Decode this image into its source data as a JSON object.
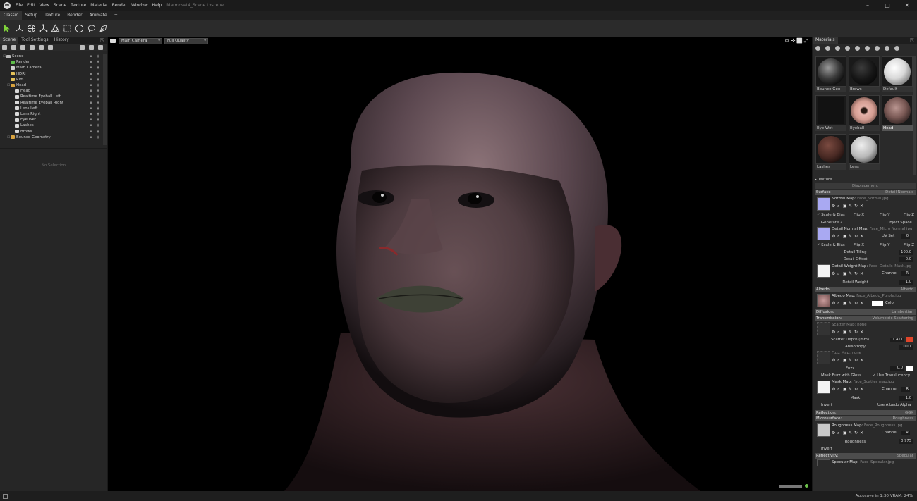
{
  "title_bar": {
    "logo_glyph": "m",
    "menu": [
      "File",
      "Edit",
      "View",
      "Scene",
      "Texture",
      "Material",
      "Render",
      "Window",
      "Help"
    ],
    "window_title": "Marmoset4_Scene.tbscene",
    "controls": [
      "–",
      "□",
      "✕"
    ]
  },
  "mode_tabs": [
    "Classic",
    "Setup",
    "Texture",
    "Render",
    "Animate",
    "+"
  ],
  "toolbar_icons": [
    "select-arrow-icon",
    "move-gizmo-icon",
    "rotate-gizmo-icon",
    "scale-gizmo-icon",
    "transform-gizmo-icon",
    "box-select-icon",
    "circle-select-icon",
    "lasso-icon",
    "paint-select-icon"
  ],
  "left_panel": {
    "tabs": [
      "Scene",
      "Tool Settings",
      "History"
    ],
    "pop_glyph": "⇱",
    "tree": [
      {
        "label": "Scene",
        "indent": 0,
        "icon": "#bbbbbb"
      },
      {
        "label": "Render",
        "indent": 1,
        "icon": "#5fbf4a"
      },
      {
        "label": "Main Camera",
        "indent": 1,
        "icon": "#cfcfcf"
      },
      {
        "label": "HDRI",
        "indent": 1,
        "icon": "#e6c35a"
      },
      {
        "label": "Rim",
        "indent": 1,
        "icon": "#e6c35a"
      },
      {
        "label": "Head",
        "indent": 1,
        "icon": "#d9a33f"
      },
      {
        "label": "Head",
        "indent": 2,
        "icon": "#d9d9d9"
      },
      {
        "label": "Realtime Eyeball Left",
        "indent": 2,
        "icon": "#d9d9d9"
      },
      {
        "label": "Realtime Eyeball Right",
        "indent": 2,
        "icon": "#d9d9d9"
      },
      {
        "label": "Lens Left",
        "indent": 2,
        "icon": "#d9d9d9"
      },
      {
        "label": "Lens Right",
        "indent": 2,
        "icon": "#d9d9d9"
      },
      {
        "label": "Eye Wet",
        "indent": 2,
        "icon": "#d9d9d9"
      },
      {
        "label": "Lashes",
        "indent": 2,
        "icon": "#d9d9d9"
      },
      {
        "label": "Brows",
        "indent": 2,
        "icon": "#d9d9d9"
      },
      {
        "label": "Bounce Geometry",
        "indent": 1,
        "icon": "#d9a33f"
      }
    ],
    "lock_glyph": "🔒",
    "eye_glyph": "👁",
    "no_selection": "No Selection"
  },
  "viewport": {
    "camera_select": "Main Camera",
    "quality_select": "Full Quality",
    "caret": "▾",
    "right_icons": [
      "⚙",
      "✛",
      "⬜",
      "⤢"
    ]
  },
  "right_panel": {
    "tab": "Materials",
    "materials": [
      {
        "label": "Bounce Geo",
        "swatch": "radial-gradient(circle at 40% 35%, #9a9a9a 0%, #3c3c3c 45%, #101010 75%)",
        "selected": false
      },
      {
        "label": "Brows",
        "swatch": "radial-gradient(circle at 40% 35%, #3c3c3c 0%, #161616 50%, #080808 80%)",
        "selected": false
      },
      {
        "label": "Default",
        "swatch": "radial-gradient(circle at 40% 35%, #ffffff 0%, #d8d8d8 45%, #7a7a7a 80%)",
        "selected": false
      },
      {
        "label": "Eye Wet",
        "swatch": "#121212",
        "selected": false
      },
      {
        "label": "Eyeball",
        "swatch": "radial-gradient(circle at 50% 50%, #2a1a14 0%, #2a1a14 14%, #e6b3aa 22%, #d49d92 50%, #6a4a44 80%)",
        "selected": false
      },
      {
        "label": "Head",
        "swatch": "radial-gradient(circle at 45% 40%, #b99590 0%, #7a5955 45%, #2e2120 80%)",
        "selected": true
      },
      {
        "label": "Lashes",
        "swatch": "radial-gradient(circle at 40% 35%, #7a4a40 0%, #4a2a24 50%, #1c100e 80%)",
        "selected": false
      },
      {
        "label": "Lens",
        "swatch": "radial-gradient(circle at 40% 35%, #eeeeee 0%, #b8b8b8 50%, #4a4a4a 85%)",
        "selected": false
      }
    ],
    "texture_label": "Texture",
    "displacement_label": "Displacement",
    "surface": {
      "title": "Surface",
      "value": "Detail Normals"
    },
    "normal_map": {
      "label": "Normal Map:",
      "file": "Face_Normal.jpg"
    },
    "scale_bias": "Scale & Bias",
    "flip_x": "Flip X",
    "flip_y": "Flip Y",
    "flip_z": "Flip Z",
    "generate_z": "Generate Z",
    "object_space": "Object Space",
    "detail_normal_map": {
      "label": "Detail Normal Map:",
      "file": "Face_Micro Normal.jpg"
    },
    "uv_set": "UV Set",
    "uv_set_value": "0",
    "detail_tiling": {
      "label": "Detail Tiling",
      "value": "100.0"
    },
    "detail_offset": {
      "label": "Detail Offset",
      "value": "0.0"
    },
    "detail_weight_map": {
      "label": "Detail Weight Map:",
      "file": "Face_Details_Mask.jpg"
    },
    "channel": "Channel",
    "channel_value": "R",
    "detail_weight": {
      "label": "Detail Weight",
      "value": "1.0"
    },
    "albedo": {
      "title": "Albedo:",
      "value": "Albedo"
    },
    "albedo_map": {
      "label": "Albedo Map:",
      "file": "Face_Albedo_Purple.jpg"
    },
    "color_label": "Color",
    "diffusion": {
      "title": "Diffusion:",
      "value": "Lambertian"
    },
    "transmission": {
      "title": "Transmission:",
      "value": "Volumetric Scattering"
    },
    "scatter_map": {
      "label": "Scatter Map:",
      "file": "none"
    },
    "scatter_depth": {
      "label": "Scatter Depth (mm)",
      "value": "1.411"
    },
    "anisotropy": {
      "label": "Anisotropy",
      "value": "0.01"
    },
    "fuzz_map": {
      "label": "Fuzz Map:",
      "file": "none"
    },
    "fuzz": {
      "label": "Fuzz",
      "value": "0.0"
    },
    "mask_fuzz_gloss": "Mask Fuzz with Gloss",
    "use_translucency": "Use Translucency",
    "mask_map": {
      "label": "Mask Map:",
      "file": "Face_Scatter map.jpg"
    },
    "mask": {
      "label": "Mask",
      "value": "1.0"
    },
    "invert": "Invert",
    "use_albedo_alpha": "Use Albedo Alpha",
    "reflection": {
      "title": "Reflection:",
      "value": "GGX"
    },
    "microsurface": {
      "title": "Microsurface:",
      "value": "Roughness"
    },
    "roughness_map": {
      "label": "Roughness Map:",
      "file": "Face_Roughness.jpg"
    },
    "roughness": {
      "label": "Roughness",
      "value": "0.975"
    },
    "reflectivity": {
      "title": "Reflectivity:",
      "value": "Specular"
    },
    "specular_map": {
      "label": "Specular Map:",
      "file": "Face_Specular.jpg"
    },
    "scatter_color": "#e0452a",
    "normal_tint": "#a9a9f2",
    "albedo_swatch": "#ffffff"
  },
  "status_bar": {
    "text": "Autosave in 1:30  VRAM: 24%"
  }
}
